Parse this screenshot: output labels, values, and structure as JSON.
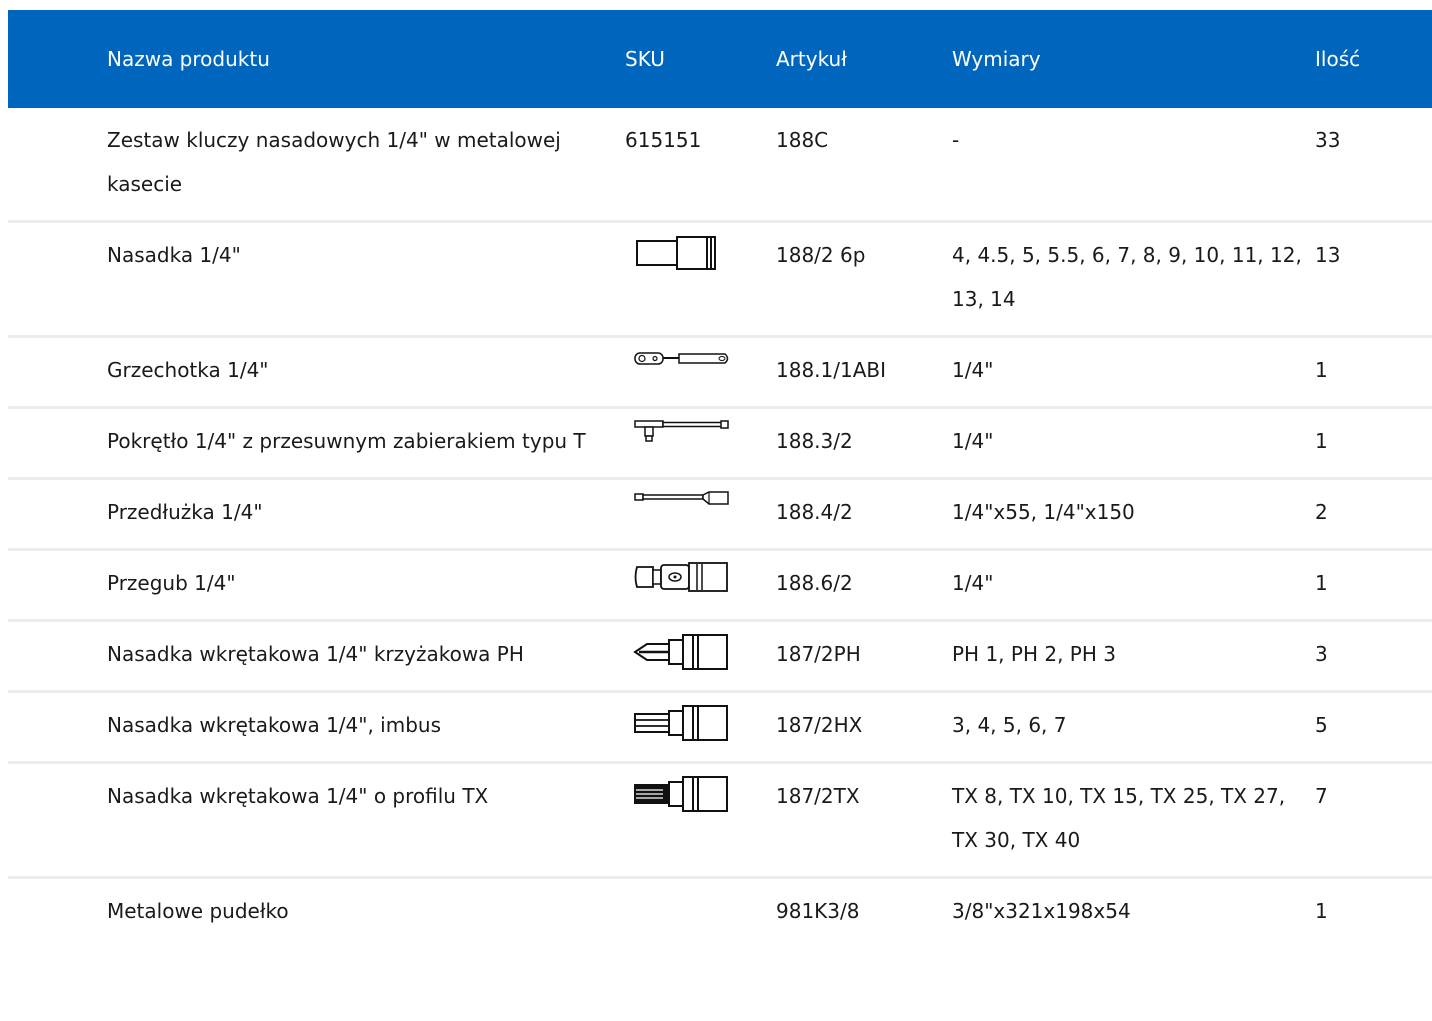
{
  "table": {
    "headers": {
      "name": "Nazwa produktu",
      "sku": "SKU",
      "article": "Artykuł",
      "dimensions": "Wymiary",
      "quantity": "Ilość"
    },
    "rows": [
      {
        "name": "Zestaw kluczy nasadowych 1/4\" w metalowej kasecie",
        "sku": "615151",
        "article": "188C",
        "dimensions": "-",
        "quantity": "33",
        "icon": ""
      },
      {
        "name": "Nasadka 1/4\"",
        "sku": "",
        "article": "188/2 6p",
        "dimensions": "4, 4.5, 5, 5.5, 6, 7, 8, 9, 10, 11, 12, 13, 14",
        "quantity": "13",
        "icon": "socket-icon"
      },
      {
        "name": "Grzechotka 1/4\"",
        "sku": "",
        "article": "188.1/1ABI",
        "dimensions": "1/4\"",
        "quantity": "1",
        "icon": "ratchet-icon"
      },
      {
        "name": "Pokrętło 1/4\" z przesuwnym zabierakiem typu T",
        "sku": "",
        "article": "188.3/2",
        "dimensions": "1/4\"",
        "quantity": "1",
        "icon": "t-handle-icon"
      },
      {
        "name": "Przedłużka 1/4\"",
        "sku": "",
        "article": "188.4/2",
        "dimensions": "1/4\"x55, 1/4\"x150",
        "quantity": "2",
        "icon": "extension-bar-icon"
      },
      {
        "name": "Przegub 1/4\"",
        "sku": "",
        "article": "188.6/2",
        "dimensions": "1/4\"",
        "quantity": "1",
        "icon": "universal-joint-icon"
      },
      {
        "name": "Nasadka wkrętakowa 1/4\" krzyżakowa PH",
        "sku": "",
        "article": "187/2PH",
        "dimensions": "PH 1, PH 2, PH 3",
        "quantity": "3",
        "icon": "phillips-bit-socket-icon"
      },
      {
        "name": "Nasadka wkrętakowa 1/4\", imbus",
        "sku": "",
        "article": "187/2HX",
        "dimensions": "3, 4, 5, 6, 7",
        "quantity": "5",
        "icon": "hex-bit-socket-icon"
      },
      {
        "name": "Nasadka wkrętakowa 1/4\" o profilu TX",
        "sku": "",
        "article": "187/2TX",
        "dimensions": "TX 8, TX 10, TX 15, TX 25, TX 27, TX 30, TX 40",
        "quantity": "7",
        "icon": "torx-bit-socket-icon"
      },
      {
        "name": "Metalowe pudełko",
        "sku": "",
        "article": "981K3/8",
        "dimensions": "3/8\"x321x198x54",
        "quantity": "1",
        "icon": ""
      }
    ]
  },
  "colors": {
    "header_bg": "#0066bd",
    "header_text": "#ffffff",
    "row_divider": "#ececec"
  }
}
